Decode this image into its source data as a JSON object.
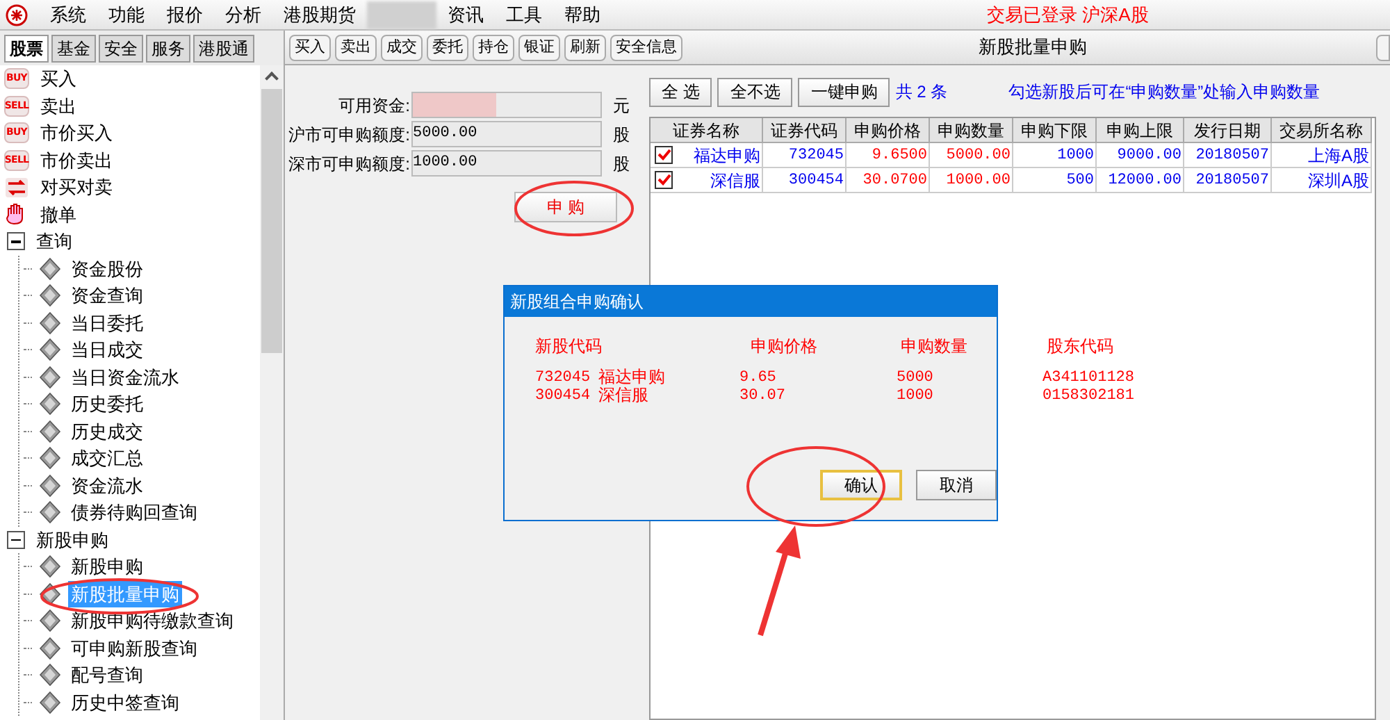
{
  "menu_bar": {
    "items": [
      "系统",
      "功能",
      "报价",
      "分析",
      "港股期货",
      "资讯",
      "工具",
      "帮助"
    ],
    "status": "交易已登录 沪深A股"
  },
  "sidebar": {
    "tabs": [
      {
        "label": "股票",
        "selected": true
      },
      {
        "label": "基金",
        "selected": false
      },
      {
        "label": "安全",
        "selected": false
      },
      {
        "label": "服务",
        "selected": false
      },
      {
        "label": "港股通",
        "selected": false
      }
    ],
    "items": [
      {
        "label": "买入",
        "kind": "badge",
        "badge": "BUY",
        "selected": false
      },
      {
        "label": "卖出",
        "kind": "badge",
        "badge": "SELL",
        "selected": false
      },
      {
        "label": "市价买入",
        "kind": "badge",
        "badge": "BUY",
        "selected": false
      },
      {
        "label": "市价卖出",
        "kind": "badge",
        "badge": "SELL",
        "selected": false
      },
      {
        "label": "对买对卖",
        "kind": "swap",
        "selected": false
      },
      {
        "label": "撤单",
        "kind": "cancel",
        "selected": false
      },
      {
        "label": "查询",
        "kind": "group",
        "expanded": true,
        "children": [
          {
            "label": "资金股份",
            "selected": false
          },
          {
            "label": "资金查询",
            "selected": false
          },
          {
            "label": "当日委托",
            "selected": false
          },
          {
            "label": "当日成交",
            "selected": false
          },
          {
            "label": "当日资金流水",
            "selected": false
          },
          {
            "label": "历史委托",
            "selected": false
          },
          {
            "label": "历史成交",
            "selected": false
          },
          {
            "label": "成交汇总",
            "selected": false
          },
          {
            "label": "资金流水",
            "selected": false
          },
          {
            "label": "债券待购回查询",
            "selected": false
          }
        ]
      },
      {
        "label": "新股申购",
        "kind": "group",
        "expanded": true,
        "children": [
          {
            "label": "新股申购",
            "selected": false
          },
          {
            "label": "新股批量申购",
            "selected": true
          },
          {
            "label": "新股申购待缴款查询",
            "selected": false
          },
          {
            "label": "可申购新股查询",
            "selected": false
          },
          {
            "label": "配号查询",
            "selected": false
          },
          {
            "label": "历史中签查询",
            "selected": false
          }
        ]
      }
    ]
  },
  "toolbar": [
    "买入",
    "卖出",
    "成交",
    "委托",
    "持仓",
    "银证",
    "刷新",
    "安全信息"
  ],
  "panel_title": "新股批量申购",
  "form": {
    "fields": [
      {
        "label": "可用资金:",
        "unit": "元",
        "redacted": true
      },
      {
        "label": "沪市可申购额度:",
        "value": "5000.00",
        "unit": "股"
      },
      {
        "label": "深市可申购额度:",
        "value": "1000.00",
        "unit": "股"
      }
    ],
    "submit": "申 购"
  },
  "actions": {
    "buttons": [
      "全 选",
      "全不选",
      "一键申购"
    ],
    "count": "共 2 条",
    "hint": "勾选新股后可在“申购数量”处输入申购数量"
  },
  "table": {
    "columns": [
      "证券名称",
      "证券代码",
      "申购价格",
      "申购数量",
      "申购下限",
      "申购上限",
      "发行日期",
      "交易所名称"
    ],
    "rows": [
      {
        "checked": true,
        "cells": [
          "福达申购",
          "732045",
          "9.6500",
          "5000.00",
          "1000",
          "9000.00",
          "20180507",
          "上海A股"
        ]
      },
      {
        "checked": true,
        "cells": [
          "深信服",
          "300454",
          "30.0700",
          "1000.00",
          "500",
          "12000.00",
          "20180507",
          "深圳A股"
        ]
      }
    ]
  },
  "dialog": {
    "title": "新股组合申购确认",
    "columns": [
      "新股代码",
      "申购价格",
      "申购数量",
      "股东代码"
    ],
    "rows": [
      {
        "code": "732045",
        "name": "福达申购",
        "price": "9.65",
        "quantity": "5000",
        "holder": "A341101128"
      },
      {
        "code": "300454",
        "name": "深信服",
        "price": "30.07",
        "quantity": "1000",
        "holder": "0158302181"
      }
    ],
    "buttons": [
      {
        "label": "确认",
        "selected": true
      },
      {
        "label": "取消",
        "selected": false
      }
    ]
  }
}
